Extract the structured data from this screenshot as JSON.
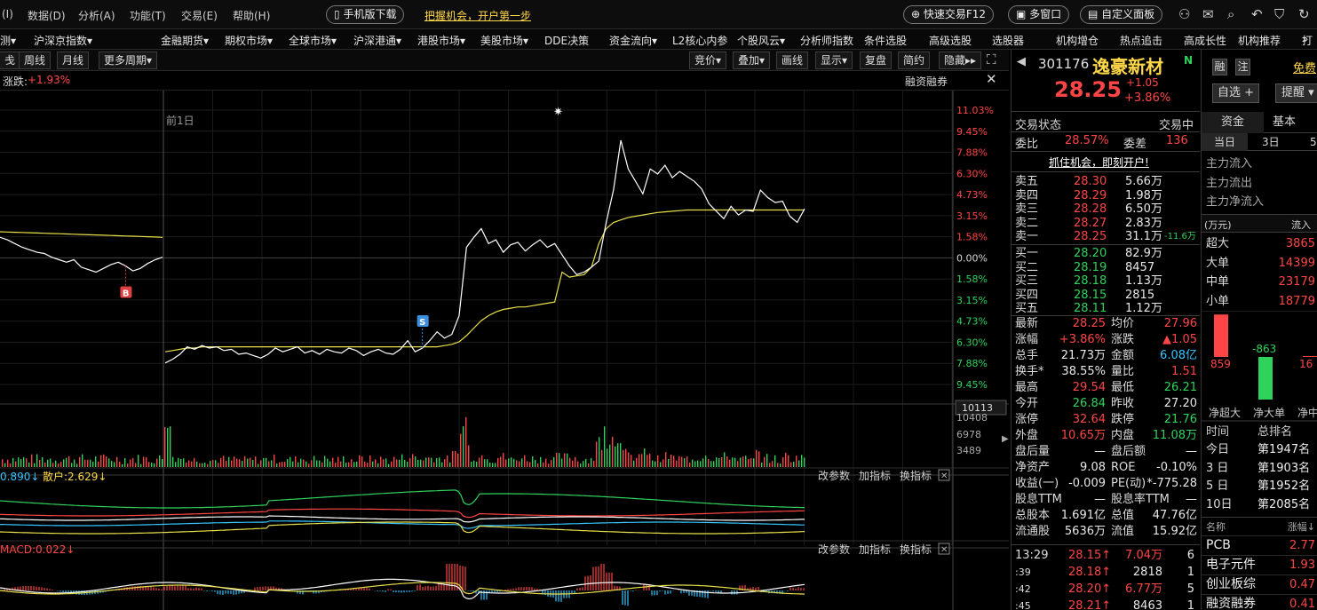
{
  "menu": {
    "items": [
      "(I)",
      "数据(D)",
      "分析(A)",
      "功能(T)",
      "交易(E)",
      "帮助(H)"
    ],
    "mobile_download": "手机版下载",
    "promo_link": "把握机会，开户第一步",
    "quick_trade": "快速交易F12",
    "multi_window": "多窗口",
    "custom_panel": "自定义面板"
  },
  "nav": {
    "items": [
      "测▾",
      "沪深京指数▾",
      "金融期货▾",
      "期权市场▾",
      "全球市场▾",
      "沪深港通▾",
      "港股市场▾",
      "美股市场▾",
      "DDE决策",
      "资金流向▾",
      "L2核心内参",
      "个股风云▾",
      "分析师指数",
      "条件选股",
      "高级选股",
      "选股器",
      "机构增仓",
      "热点追击",
      "高成长性",
      "机构推荐",
      "»",
      "打"
    ]
  },
  "toolbar": {
    "left": [
      "戋",
      "周线",
      "月线",
      "更多周期▾"
    ],
    "right": [
      "竞价▾",
      "叠加▾",
      "画线",
      "显示▾",
      "复盘",
      "简约",
      "隐藏▸▸"
    ]
  },
  "chart_header": {
    "change_label": "涨跌:",
    "change_value": "+1.93%",
    "margin_label": "融资融券",
    "prev_day_label": "前1日"
  },
  "chart_data": {
    "type": "line",
    "price_axis_right": [
      "11.03%",
      "9.45%",
      "7.88%",
      "6.30%",
      "4.73%",
      "3.15%",
      "1.58%",
      "0.00%",
      "1.58%",
      "3.15%",
      "4.73%",
      "6.30%",
      "7.88%",
      "9.45%"
    ],
    "price_axis_dir": [
      1,
      1,
      1,
      1,
      1,
      1,
      1,
      0,
      -1,
      -1,
      -1,
      -1,
      -1,
      -1
    ],
    "volume_axis": [
      "10113",
      "10408",
      "6978",
      "3489"
    ],
    "markers": [
      {
        "label": "B",
        "color": "#e04040"
      },
      {
        "label": "S",
        "color": "#3a8fe0"
      }
    ],
    "prev_day": {
      "price": [
        0.8,
        0.6,
        0.3,
        0.0,
        -0.2,
        -0.4,
        -0.5,
        -0.8,
        -1.0,
        -1.2,
        -1.0,
        -1.6,
        -1.8,
        -2.0,
        -1.7,
        -1.4,
        -1.2,
        -1.5,
        -1.9,
        -1.7,
        -1.3,
        -1.0,
        -0.8
      ],
      "avg": [
        1.25,
        1.23,
        1.21,
        1.19,
        1.17,
        1.15,
        1.13,
        1.11,
        1.09,
        1.07,
        1.05,
        1.03,
        1.01,
        0.99,
        0.97,
        0.95,
        0.93,
        0.91,
        0.89,
        0.87,
        0.85,
        0.83,
        0.8
      ]
    },
    "today": {
      "price": [
        -9.3,
        -9.0,
        -8.6,
        -8.0,
        -8.2,
        -7.9,
        -8.1,
        -8.0,
        -8.3,
        -8.2,
        -8.6,
        -8.5,
        -8.7,
        -8.9,
        -8.6,
        -8.1,
        -8.4,
        -8.2,
        -8.0,
        -8.5,
        -8.3,
        -8.6,
        -8.2,
        -8.4,
        -8.5,
        -8.1,
        -8.3,
        -8.7,
        -8.4,
        -8.2,
        -8.5,
        -8.6,
        -8.2,
        -7.5,
        -8.4,
        -8.1,
        -7.5,
        -6.8,
        -7.3,
        -7.0,
        -5.5,
        0.0,
        0.8,
        1.5,
        0.3,
        0.6,
        -0.4,
        0.2,
        0.4,
        -0.3,
        0.2,
        0.6,
        0.0,
        0.3,
        -0.6,
        -1.5,
        -2.2,
        -2.0,
        -1.6,
        -1.1,
        2.0,
        4.6,
        8.6,
        6.3,
        5.3,
        4.3,
        6.3,
        5.9,
        6.6,
        5.6,
        6.1,
        5.7,
        5.3,
        4.7,
        3.5,
        2.9,
        2.3,
        3.3,
        2.6,
        3.0,
        2.9,
        4.6,
        4.0,
        3.6,
        3.7,
        2.5,
        2.0,
        3.1
      ],
      "avg": [
        -8.4,
        -8.3,
        -8.2,
        -8.1,
        -8.1,
        -8.0,
        -8.0,
        -8.0,
        -8.0,
        -8.0,
        -8.0,
        -8.0,
        -8.0,
        -8.0,
        -8.0,
        -8.0,
        -8.0,
        -8.0,
        -8.0,
        -8.0,
        -8.0,
        -8.0,
        -8.0,
        -8.0,
        -8.0,
        -8.0,
        -8.0,
        -8.0,
        -8.0,
        -8.0,
        -8.0,
        -8.0,
        -8.0,
        -8.0,
        -8.0,
        -8.0,
        -8.0,
        -8.0,
        -7.9,
        -7.8,
        -7.6,
        -7.1,
        -6.5,
        -5.9,
        -5.5,
        -5.2,
        -5.0,
        -4.9,
        -4.8,
        -4.8,
        -4.7,
        -4.6,
        -4.5,
        -4.4,
        -2.0,
        -2.4,
        -2.3,
        -2.2,
        -1.6,
        0.3,
        1.5,
        2.0,
        2.2,
        2.4,
        2.5,
        2.6,
        2.7,
        2.8,
        2.85,
        2.9,
        2.95,
        3.0,
        3.0,
        3.0,
        3.0,
        3.0,
        3.0,
        3.0,
        3.0,
        3.0,
        3.0,
        3.0,
        3.0,
        3.0,
        3.0,
        3.0,
        3.0,
        3.0
      ]
    },
    "ind1": {
      "label_left": "0.890↓",
      "label_mid": "散户:2.629↓"
    },
    "ind2": {
      "label": "MACD:0.022↓"
    },
    "ind_buttons": [
      "改参数",
      "加指标",
      "换指标"
    ]
  },
  "quote": {
    "code": "301176",
    "name": "逸豪新材",
    "price": "28.25",
    "change": "+1.05",
    "change_pct": "+3.86%",
    "btn_margin": "融",
    "btn_note": "注",
    "btn_free": "免费",
    "btn_watch": "自选 +",
    "btn_remind": "提醒 ▾",
    "trade_status_label": "交易状态",
    "trade_status": "交易中",
    "wb_label": "委比",
    "wb": "28.57%",
    "wc_label": "委差",
    "wc": "136",
    "promo": "抓住机会，即刻开户!",
    "asks": [
      {
        "l": "卖五",
        "p": "28.30",
        "v": "5.66万"
      },
      {
        "l": "卖四",
        "p": "28.29",
        "v": "1.98万"
      },
      {
        "l": "卖三",
        "p": "28.28",
        "v": "6.50万"
      },
      {
        "l": "卖二",
        "p": "28.27",
        "v": "2.83万"
      },
      {
        "l": "卖一",
        "p": "28.25",
        "v": "31.1万",
        "x": "-11.6万"
      }
    ],
    "bids": [
      {
        "l": "买一",
        "p": "28.20",
        "v": "82.9万"
      },
      {
        "l": "买二",
        "p": "28.19",
        "v": "8457"
      },
      {
        "l": "买三",
        "p": "28.18",
        "v": "1.13万"
      },
      {
        "l": "买四",
        "p": "28.15",
        "v": "2815"
      },
      {
        "l": "买五",
        "p": "28.11",
        "v": "1.12万"
      }
    ],
    "stats": [
      {
        "a": "最新",
        "av": "28.25",
        "ac": "r",
        "b": "均价",
        "bv": "27.96",
        "bc": "r"
      },
      {
        "a": "涨幅",
        "av": "+3.86%",
        "ac": "r",
        "b": "涨跌",
        "bv": "▲1.05",
        "bc": "r"
      },
      {
        "a": "总手",
        "av": "21.73万",
        "ac": "w",
        "b": "金额",
        "bv": "6.08亿",
        "bc": "c"
      },
      {
        "a": "换手*",
        "av": "38.55%",
        "ac": "w",
        "b": "量比",
        "bv": "1.51",
        "bc": "r"
      },
      {
        "a": "最高",
        "av": "29.54",
        "ac": "r",
        "b": "最低",
        "bv": "26.21",
        "bc": "g"
      },
      {
        "a": "今开",
        "av": "26.84",
        "ac": "g",
        "b": "昨收",
        "bv": "27.20",
        "bc": "w"
      },
      {
        "a": "涨停",
        "av": "32.64",
        "ac": "r",
        "b": "跌停",
        "bv": "21.76",
        "bc": "g"
      },
      {
        "a": "外盘",
        "av": "10.65万",
        "ac": "r",
        "b": "内盘",
        "bv": "11.08万",
        "bc": "g"
      },
      {
        "a": "盘后量",
        "av": "—",
        "ac": "w",
        "b": "盘后额",
        "bv": "—",
        "bc": "w"
      },
      {
        "a": "净资产",
        "av": "9.08",
        "ac": "w",
        "b": "ROE",
        "bv": "-0.10%",
        "bc": "w"
      },
      {
        "a": "收益(一)",
        "av": "-0.009",
        "ac": "w",
        "b": "PE(动)",
        "bv": "*-775.28",
        "bc": "w"
      },
      {
        "a": "股息TTM",
        "av": "—",
        "ac": "w",
        "b": "股息率TTM",
        "bv": "—",
        "bc": "w"
      },
      {
        "a": "总股本",
        "av": "1.691亿",
        "ac": "w",
        "b": "总值",
        "bv": "47.76亿",
        "bc": "w"
      },
      {
        "a": "流通股",
        "av": "5636万",
        "ac": "w",
        "b": "流值",
        "bv": "15.92亿",
        "bc": "w"
      }
    ],
    "ticks": [
      {
        "t": "13:29",
        "p": "28.15↑",
        "v": "7.04万",
        "n": "6",
        "vc": "r"
      },
      {
        "t": ":39",
        "p": "28.18↑",
        "v": "2818",
        "n": "1",
        "vc": "w"
      },
      {
        "t": ":42",
        "p": "28.20↑",
        "v": "6.77万",
        "n": "5",
        "vc": "r"
      },
      {
        "t": ":45",
        "p": "28.21↑",
        "v": "8463",
        "n": "1",
        "vc": "w"
      }
    ]
  },
  "flow": {
    "tabs": [
      "资金",
      "基本"
    ],
    "periods": [
      "当日",
      "3日",
      "5"
    ],
    "items": [
      "主力流入",
      "主力流出",
      "主力净流入"
    ],
    "unit": "(万元)",
    "in_label": "流入",
    "sizes": [
      {
        "l": "超大",
        "v": "3865"
      },
      {
        "l": "大单",
        "v": "14399"
      },
      {
        "l": "中单",
        "v": "23179"
      },
      {
        "l": "小单",
        "v": "18779"
      }
    ],
    "bars": [
      {
        "v": "859",
        "dir": 1
      },
      {
        "v": "-863",
        "dir": -1
      },
      {
        "v": "16",
        "dir": 1
      }
    ],
    "bar_labels": [
      "净超大",
      "净大单",
      "净中"
    ],
    "rank_head": [
      "时间",
      "总排名"
    ],
    "ranks": [
      {
        "t": "今日",
        "r": "第1947名"
      },
      {
        "t": "3 日",
        "r": "第1903名"
      },
      {
        "t": "5 日",
        "r": "第1952名"
      },
      {
        "t": "10日",
        "r": "第2085名"
      }
    ],
    "sector_head": [
      "名称",
      "涨幅↓"
    ],
    "sectors": [
      {
        "n": "PCB",
        "v": "2.77"
      },
      {
        "n": "电子元件",
        "v": "1.93"
      },
      {
        "n": "创业板综",
        "v": "0.47"
      },
      {
        "n": "融资融券",
        "v": "0.41"
      }
    ]
  },
  "colors": {
    "up": "#ff4545",
    "down": "#2fd35c",
    "price_line": "#ffffff",
    "avg_line": "#e8e04a",
    "accent": "#ffd84a"
  }
}
